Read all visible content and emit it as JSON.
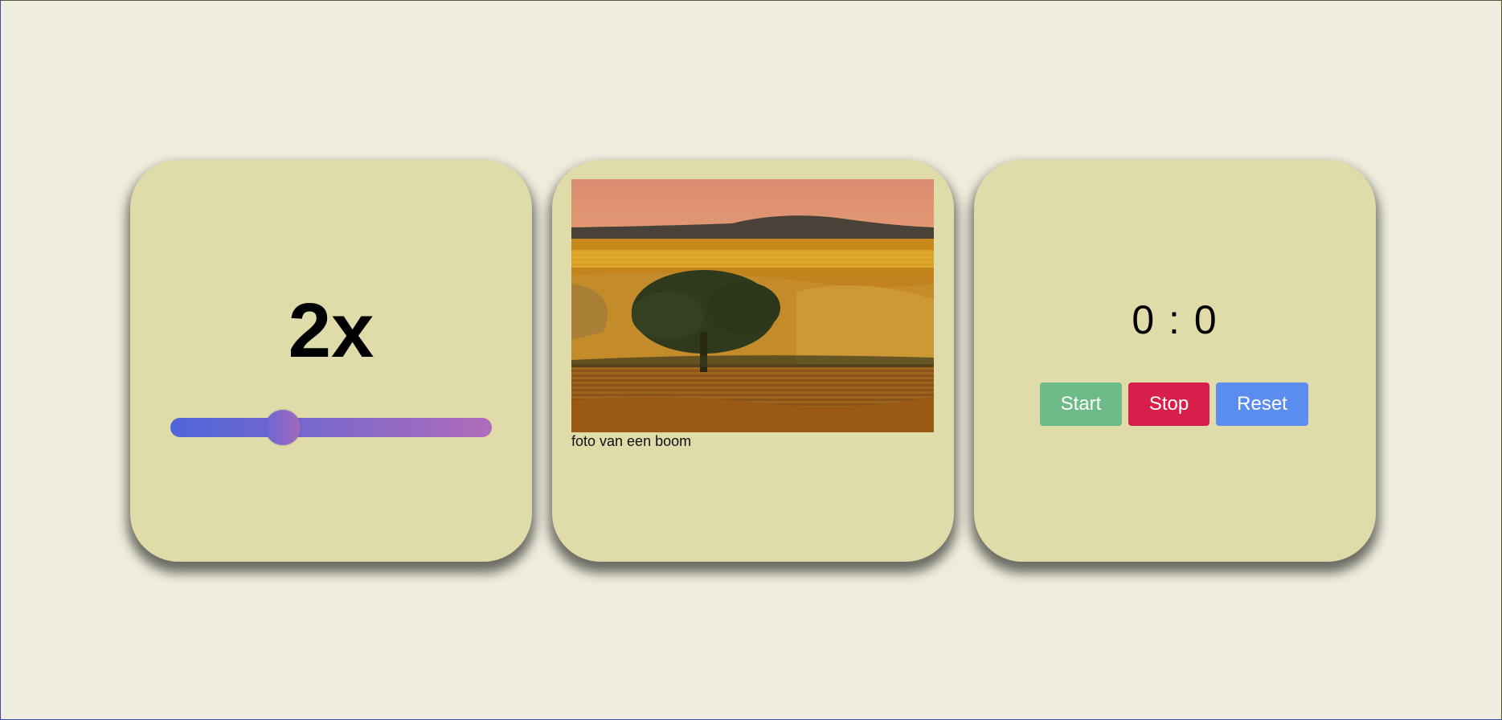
{
  "speed_card": {
    "value_label": "2x",
    "slider": {
      "value_fraction": 0.35,
      "colors": {
        "start": "#4f65da",
        "end": "#b06cba"
      }
    }
  },
  "photo_card": {
    "image_alt": "foto van een boom",
    "caption": "foto van een boom"
  },
  "timer_card": {
    "display": "0 : 0",
    "buttons": {
      "start": "Start",
      "stop": "Stop",
      "reset": "Reset"
    },
    "colors": {
      "start": "#6dbb86",
      "stop": "#d81e4a",
      "reset": "#5b8df1"
    }
  },
  "colors": {
    "page_background": "#efeddd",
    "card_background": "#dfdcaa"
  }
}
